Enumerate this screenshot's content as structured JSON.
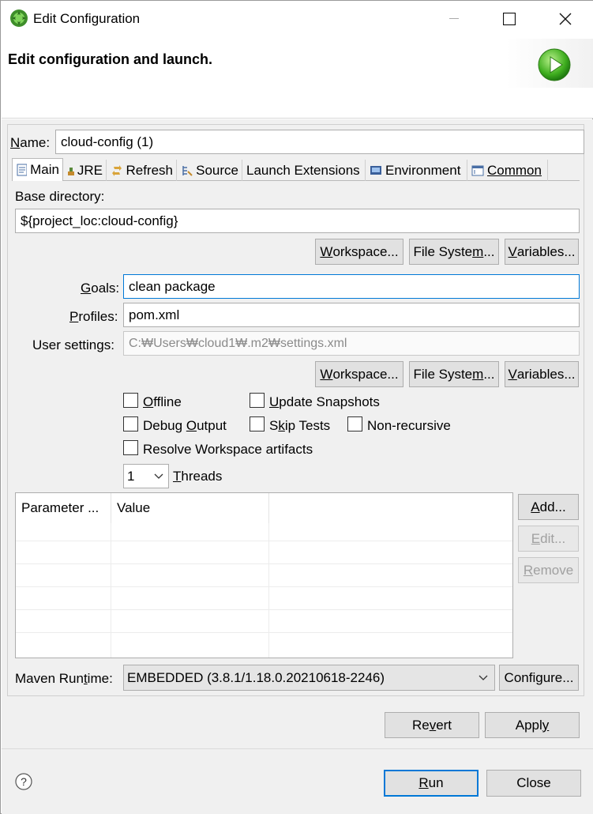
{
  "window": {
    "title": "Edit Configuration",
    "header": "Edit configuration and launch."
  },
  "name_field": {
    "label_u": "N",
    "label_rest": "ame:",
    "value": "cloud-config (1)"
  },
  "tabs": [
    {
      "label": "Main",
      "icon": "main-tab-icon",
      "selected": true
    },
    {
      "label": "JRE",
      "icon": "jre-icon"
    },
    {
      "label": "Refresh",
      "icon": "refresh-icon"
    },
    {
      "label": "Source",
      "icon": "source-icon"
    },
    {
      "label": "Launch Extensions",
      "icon": ""
    },
    {
      "label": "Environment",
      "icon": "environment-icon"
    },
    {
      "label": "Common",
      "icon": "common-icon"
    }
  ],
  "base_directory": {
    "label": "Base directory:",
    "value": "${project_loc:cloud-config}"
  },
  "dir_buttons": {
    "workspace_u": "W",
    "workspace_rest": "orkspace...",
    "filesystem_pre": "File Syste",
    "filesystem_u": "m",
    "filesystem_post": "...",
    "variables_u": "V",
    "variables_rest": "ariables..."
  },
  "goals": {
    "label_u": "G",
    "label_rest": "oals:",
    "value": "clean package"
  },
  "profiles": {
    "label_u": "P",
    "label_rest": "rofiles:",
    "value": "pom.xml"
  },
  "user_settings": {
    "label": "User settings:",
    "value": "C:\\Users\\cloud1\\.m2\\settings.xml",
    "display": "C:₩Users₩cloud1₩.m2₩settings.xml"
  },
  "settings_buttons": {
    "workspace_u": "W",
    "workspace_rest": "orkspace...",
    "filesystem_pre": "File Syste",
    "filesystem_u": "m",
    "filesystem_post": "...",
    "variables_u": "V",
    "variables_rest": "ariables..."
  },
  "checkboxes": {
    "offline": {
      "u": "O",
      "rest": "ffline",
      "checked": false
    },
    "update_snapshots": {
      "u": "U",
      "rest": "pdate Snapshots",
      "checked": false
    },
    "debug_output": {
      "pre": "Debug ",
      "u": "O",
      "post": "utput",
      "checked": false
    },
    "skip_tests": {
      "pre": "S",
      "u": "k",
      "post": "ip Tests",
      "checked": false
    },
    "non_recursive": {
      "label": "Non-recursive",
      "checked": false
    },
    "resolve_workspace": {
      "label": "Resolve Workspace artifacts",
      "checked": false
    }
  },
  "threads": {
    "value": "1",
    "label_u": "T",
    "label_rest": "hreads"
  },
  "params_table": {
    "columns": [
      "Parameter ...",
      "Value"
    ],
    "rows": []
  },
  "param_buttons": {
    "add_u": "A",
    "add_rest": "dd...",
    "edit_u": "E",
    "edit_rest": "dit...",
    "remove_u": "R",
    "remove_rest": "emove"
  },
  "maven_runtime": {
    "label_pre": "Maven Run",
    "label_u": "t",
    "label_post": "ime:",
    "value": "EMBEDDED (3.8.1/1.18.0.20210618-2246)",
    "configure_label": "Configure..."
  },
  "footer": {
    "revert_pre": "Re",
    "revert_u": "v",
    "revert_post": "ert",
    "apply_pre": "Appl",
    "apply_u": "y",
    "apply_post": "",
    "run_u": "R",
    "run_rest": "un",
    "close_label": "Close"
  },
  "colors": {
    "focus": "#0078d7",
    "dialog_bg": "#f0f0f0",
    "button_bg": "#e1e1e1"
  }
}
